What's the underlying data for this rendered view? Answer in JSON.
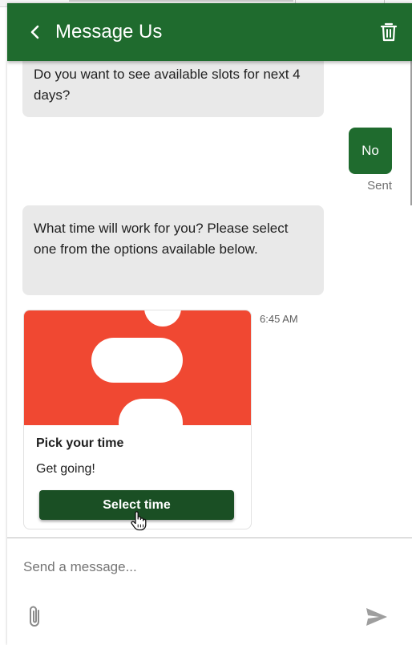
{
  "header": {
    "title": "Message Us",
    "back_icon": "chevron-left-icon",
    "delete_icon": "trash-icon",
    "color": "#1f6b2e"
  },
  "messages": [
    {
      "direction": "incoming",
      "text": "Do you want to see available slots for next 4 days?"
    },
    {
      "direction": "outgoing",
      "text": "No",
      "status": "Sent"
    },
    {
      "direction": "incoming",
      "text": "What time will work for you? Please select one from the options available below."
    }
  ],
  "card": {
    "title": "Pick your time",
    "subtitle": "Get going!",
    "button_label": "Select time",
    "timestamp": "6:45 AM",
    "image_color": "#f04832",
    "button_color": "#1a4f24"
  },
  "composer": {
    "placeholder": "Send a message...",
    "value": "",
    "attach_icon": "paperclip-icon",
    "send_icon": "send-icon"
  }
}
